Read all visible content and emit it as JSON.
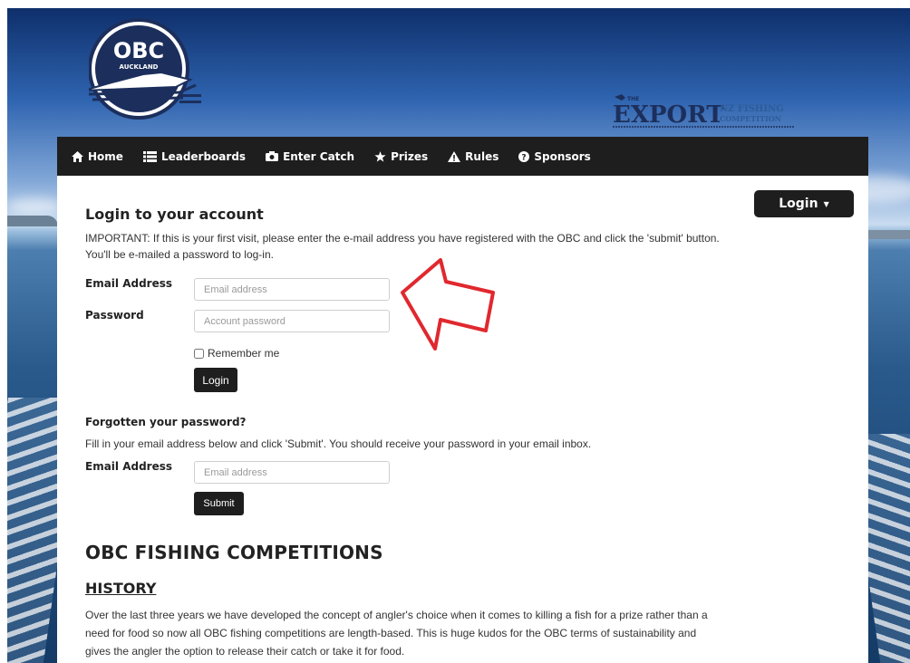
{
  "header": {
    "obc_logo": {
      "title": "OBC",
      "subtitle": "AUCKLAND"
    },
    "sponsor_logo": {
      "line1": "THE",
      "main": "EXPORT",
      "line2": "NZ FISHING",
      "line3": "COMPETITION"
    }
  },
  "nav": {
    "items": [
      {
        "label": "Home",
        "icon": "home-icon"
      },
      {
        "label": "Leaderboards",
        "icon": "list-icon"
      },
      {
        "label": "Enter Catch",
        "icon": "camera-icon"
      },
      {
        "label": "Prizes",
        "icon": "star-icon"
      },
      {
        "label": "Rules",
        "icon": "warning-icon"
      },
      {
        "label": "Sponsors",
        "icon": "question-circle-icon"
      }
    ],
    "login_dropdown": "Login"
  },
  "login": {
    "title": "Login to your account",
    "intro": "IMPORTANT: If this is your first visit, please enter the e-mail address you have registered with the OBC and click the 'submit' button. You'll be e-mailed a password to log-in.",
    "email_label": "Email Address",
    "email_placeholder": "Email address",
    "password_label": "Password",
    "password_placeholder": "Account password",
    "remember_label": "Remember me",
    "remember_checked": false,
    "login_button": "Login"
  },
  "forgot": {
    "title": "Forgotten your password?",
    "text": "Fill in your email address below and click 'Submit'. You should receive your password in your email inbox.",
    "email_label": "Email Address",
    "email_placeholder": "Email address",
    "submit_button": "Submit"
  },
  "competitions": {
    "title": "OBC FISHING COMPETITIONS",
    "history_heading": "HISTORY",
    "history_text": "Over the last three years we have developed the concept of angler's choice when it comes to killing a fish for a prize rather than a need for food so now all OBC fishing competitions are length-based. This is huge kudos for the OBC terms of sustainability and gives the angler the option to release their catch or take it for food."
  },
  "colors": {
    "navbar": "#1e1e1e",
    "button": "#1e1e1e",
    "arrow": "#e0282e",
    "logo_navy": "#1c2f5c"
  }
}
